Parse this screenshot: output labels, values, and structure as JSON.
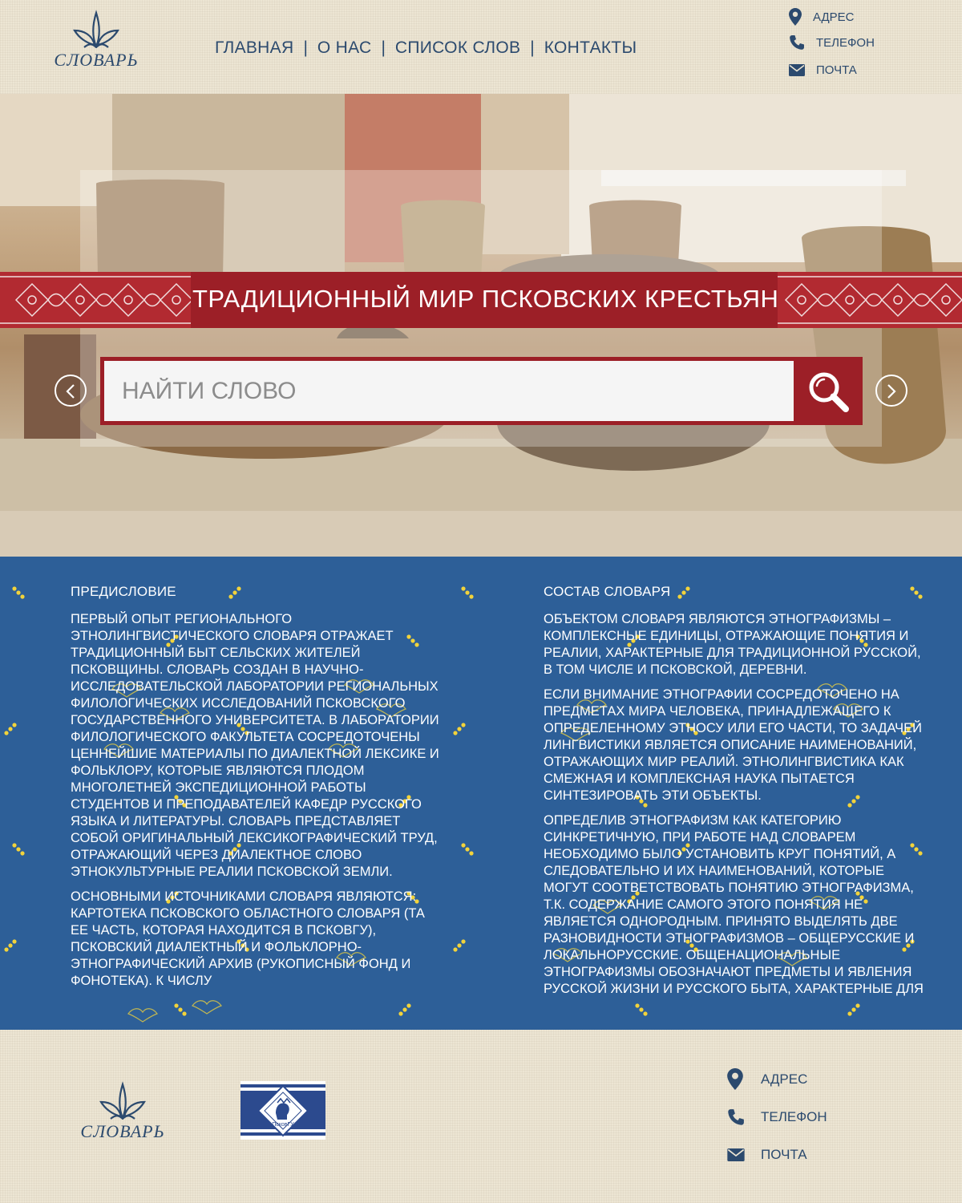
{
  "header": {
    "logo_text": "СЛОВАРЬ",
    "nav": [
      "ГЛАВНАЯ",
      "О НАС",
      "СПИСОК СЛОВ",
      "КОНТАКТЫ"
    ],
    "nav_separator": "|",
    "contacts": {
      "address": "АДРЕС",
      "phone": "ТЕЛЕФОН",
      "email": "ПОЧТА"
    }
  },
  "hero": {
    "title": "ТРАДИЦИОННЫЙ МИР ПСКОВСКИХ КРЕСТЬЯН",
    "search": {
      "placeholder": "НАЙТИ СЛОВО"
    }
  },
  "content": {
    "left": {
      "heading": "ПРЕДИСЛОВИЕ",
      "paragraphs": [
        "ПЕРВЫЙ ОПЫТ РЕГИОНАЛЬНОГО ЭТНОЛИНГВИСТИЧЕСКОГО СЛОВАРЯ ОТРАЖАЕТ ТРАДИЦИОННЫЙ БЫТ СЕЛЬСКИХ ЖИТЕЛЕЙ ПСКОВЩИНЫ. СЛОВАРЬ СОЗДАН В НАУЧНО-ИССЛЕДОВАТЕЛЬСКОЙ ЛАБОРАТОРИИ РЕГИОНАЛЬНЫХ ФИЛОЛОГИЧЕСКИХ ИССЛЕДОВАНИЙ ПСКОВСКОГО ГОСУДАРСТВЕННОГО УНИВЕРСИТЕТА. В ЛАБОРАТОРИИ ФИЛОЛОГИЧЕСКОГО ФАКУЛЬТЕТА СОСРЕДОТОЧЕНЫ ЦЕННЕЙШИЕ МАТЕРИАЛЫ ПО ДИАЛЕКТНОЙ ЛЕКСИКЕ И ФОЛЬКЛОРУ, КОТОРЫЕ ЯВЛЯЮТСЯ ПЛОДОМ МНОГОЛЕТНЕЙ ЭКСПЕДИЦИОННОЙ РАБОТЫ СТУДЕНТОВ И ПРЕПОДАВАТЕЛЕЙ КАФЕДР РУССКОГО ЯЗЫКА И ЛИТЕРАТУРЫ. СЛОВАРЬ ПРЕДСТАВЛЯЕТ СОБОЙ ОРИГИНАЛЬНЫЙ ЛЕКСИКОГРАФИЧЕСКИЙ ТРУД, ОТРАЖАЮЩИЙ ЧЕРЕЗ ДИАЛЕКТНОЕ СЛОВО ЭТНОКУЛЬТУРНЫЕ РЕАЛИИ ПСКОВСКОЙ ЗЕМЛИ.",
        "ОСНОВНЫМИ ИСТОЧНИКАМИ СЛОВАРЯ ЯВЛЯЮТСЯ: КАРТОТЕКА ПСКОВСКОГО ОБЛАСТНОГО СЛОВАРЯ (ТА ЕЕ ЧАСТЬ, КОТОРАЯ НАХОДИТСЯ В ПСКОВГУ), ПСКОВСКИЙ ДИАЛЕКТНЫЙ И ФОЛЬКЛОРНО-ЭТНОГРАФИЧЕСКИЙ АРХИВ (РУКОПИСНЫЙ ФОНД И ФОНОТЕКА). К ЧИСЛУ"
      ]
    },
    "right": {
      "heading": "СОСТАВ СЛОВАРЯ",
      "paragraphs": [
        "ОБЪЕКТОМ СЛОВАРЯ ЯВЛЯЮТСЯ ЭТНОГРАФИЗМЫ – КОМПЛЕКСНЫЕ ЕДИНИЦЫ, ОТРАЖАЮЩИЕ ПОНЯТИЯ И РЕАЛИИ, ХАРАКТЕРНЫЕ ДЛЯ ТРАДИЦИОННОЙ РУССКОЙ, В ТОМ ЧИСЛЕ И ПСКОВСКОЙ, ДЕРЕВНИ.",
        "ЕСЛИ ВНИМАНИЕ ЭТНОГРАФИИ СОСРЕДОТОЧЕНО НА ПРЕДМЕТАХ МИРА ЧЕЛОВЕКА, ПРИНАДЛЕЖАЩЕГО К ОПРЕДЕЛЕННОМУ ЭТНОСУ ИЛИ ЕГО ЧАСТИ, ТО ЗАДАЧЕЙ ЛИНГВИСТИКИ ЯВЛЯЕТСЯ ОПИСАНИЕ НАИМЕНОВАНИЙ, ОТРАЖАЮЩИХ МИР РЕАЛИЙ. ЭТНОЛИНГВИСТИКА КАК СМЕЖНАЯ И КОМПЛЕКСНАЯ НАУКА ПЫТАЕТСЯ СИНТЕЗИРОВАТЬ ЭТИ ОБЪЕКТЫ.",
        "ОПРЕДЕЛИВ ЭТНОГРАФИЗМ КАК КАТЕГОРИЮ СИНКРЕТИЧНУЮ, ПРИ РАБОТЕ НАД СЛОВАРЕМ НЕОБХОДИМО БЫЛО УСТАНОВИТЬ КРУГ ПОНЯТИЙ, А СЛЕДОВАТЕЛЬНО И ИХ НАИМЕНОВАНИЙ, КОТОРЫЕ МОГУТ СООТВЕТСТВОВАТЬ ПОНЯТИЮ ЭТНОГРАФИЗМА, Т.К. СОДЕРЖАНИЕ САМОГО ЭТОГО ПОНЯТИЯ НЕ ЯВЛЯЕТСЯ ОДНОРОДНЫМ. ПРИНЯТО ВЫДЕЛЯТЬ ДВЕ РАЗНОВИДНОСТИ ЭТНОГРАФИЗМОВ – ОБЩЕРУССКИЕ И ЛОКАЛЬНОРУССКИЕ. ОБЩЕНАЦИОНАЛЬНЫЕ ЭТНОГРАФИЗМЫ ОБОЗНАЧАЮТ ПРЕДМЕТЫ И ЯВЛЕНИЯ РУССКОЙ ЖИЗНИ И РУССКОГО БЫТА, ХАРАКТЕРНЫЕ ДЛЯ"
      ]
    }
  },
  "footer": {
    "logo_text": "СЛОВАРЬ",
    "university_logo_text": "ПсковГУ",
    "contacts": {
      "address": "АДРЕС",
      "phone": "ТЕЛЕФОН",
      "email": "ПОЧТА"
    }
  },
  "colors": {
    "navy": "#2c4a6e",
    "banner_red": "#9c1f27",
    "content_blue": "#2d5f98",
    "dot_yellow": "#f2d33b",
    "linen": "#ece5d3"
  },
  "icons": [
    "logo-sprout-icon",
    "location-pin-icon",
    "phone-icon",
    "envelope-icon",
    "search-icon",
    "chevron-left-icon",
    "chevron-right-icon",
    "ornament-icon",
    "university-emblem-icon"
  ]
}
